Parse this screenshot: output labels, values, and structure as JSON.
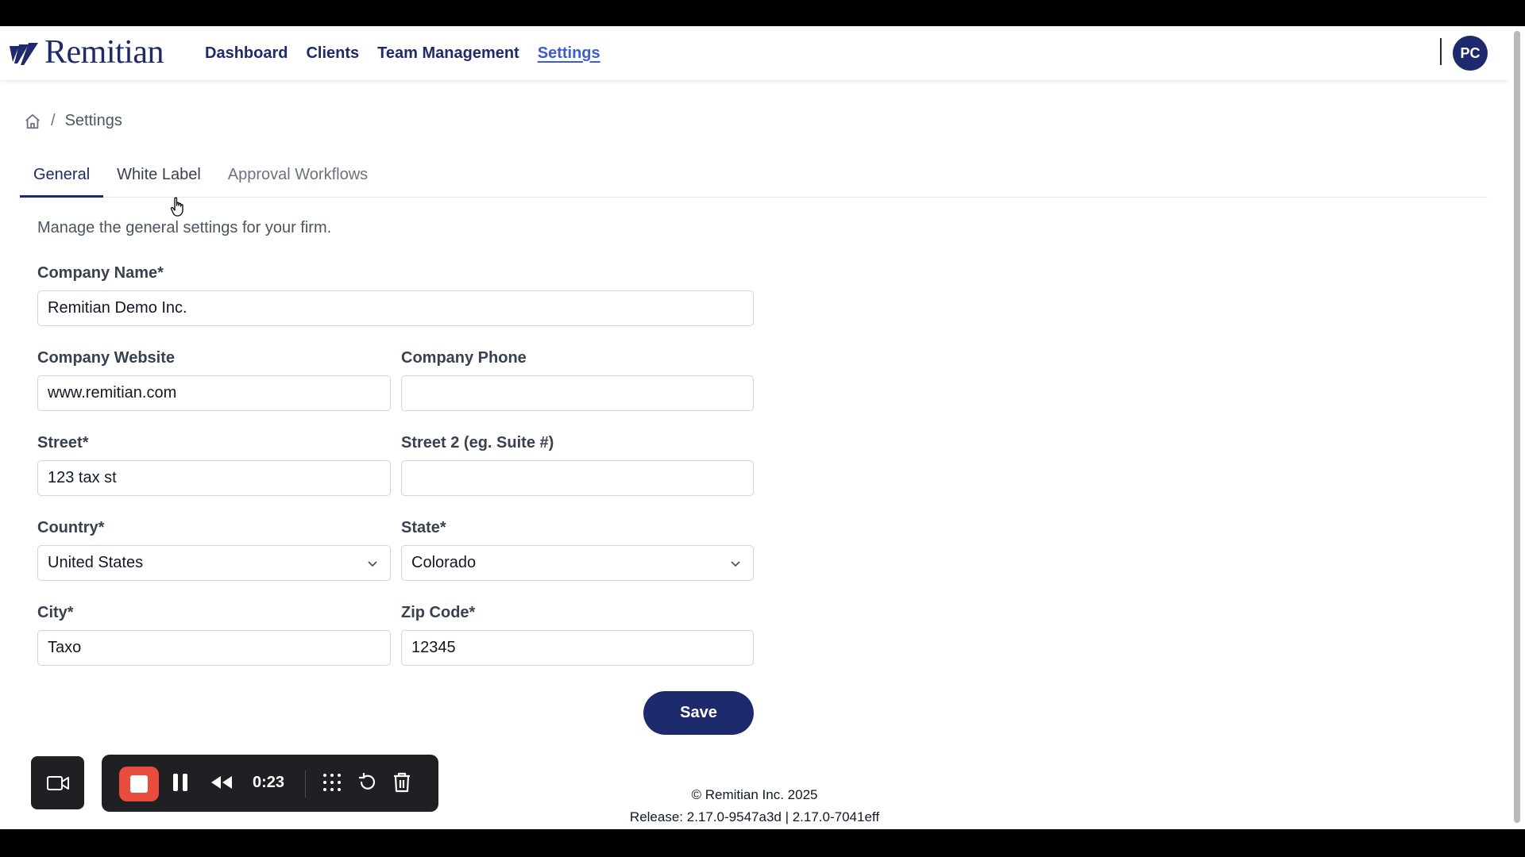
{
  "nav": {
    "logo_text": "Remitian",
    "links": [
      "Dashboard",
      "Clients",
      "Team Management",
      "Settings"
    ],
    "avatar_initials": "PC"
  },
  "breadcrumb": {
    "current": "Settings"
  },
  "tabs": [
    "General",
    "White Label",
    "Approval Workflows"
  ],
  "intro": "Manage the general settings for your firm.",
  "form": {
    "company_name": {
      "label": "Company Name*",
      "value": "Remitian Demo Inc."
    },
    "company_website": {
      "label": "Company Website",
      "value": "www.remitian.com"
    },
    "company_phone": {
      "label": "Company Phone",
      "value": ""
    },
    "street": {
      "label": "Street*",
      "value": "123 tax st"
    },
    "street2": {
      "label": "Street 2 (eg. Suite #)",
      "value": ""
    },
    "country": {
      "label": "Country*",
      "value": "United States"
    },
    "state": {
      "label": "State*",
      "value": "Colorado"
    },
    "city": {
      "label": "City*",
      "value": "Taxo"
    },
    "zip": {
      "label": "Zip Code*",
      "value": "12345"
    },
    "save_label": "Save"
  },
  "footer": {
    "copyright": "© Remitian Inc. 2025",
    "release": "Release: 2.17.0-9547a3d | 2.17.0-7041eff"
  },
  "recorder": {
    "time": "0:23"
  },
  "colors": {
    "brand": "#1e2a6e",
    "active_link": "#3b5bdb",
    "record": "#e74c3c"
  }
}
